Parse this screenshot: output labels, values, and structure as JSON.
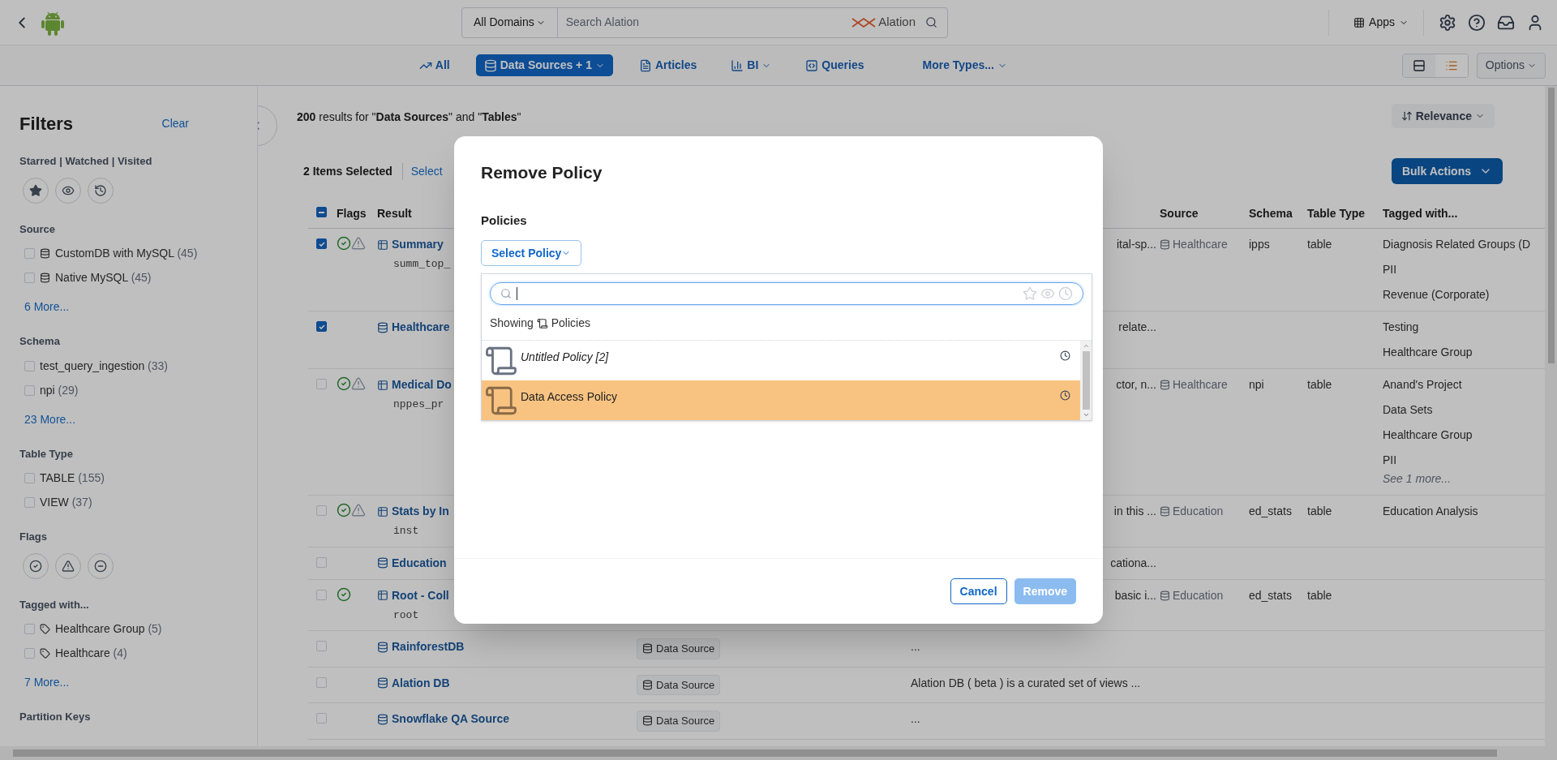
{
  "topbar": {
    "domain": "All Domains",
    "search_placeholder": "Search Alation",
    "logo_text": "Alation",
    "apps": "Apps"
  },
  "type_tabs": [
    {
      "label": "All",
      "caret": false,
      "selected": false
    },
    {
      "label": "Data Sources + 1",
      "caret": true,
      "selected": true
    },
    {
      "label": "Articles",
      "caret": false,
      "selected": false
    },
    {
      "label": "BI",
      "caret": true,
      "selected": false
    },
    {
      "label": "Queries",
      "caret": false,
      "selected": false
    },
    {
      "label": "More Types...",
      "caret": true,
      "selected": false
    }
  ],
  "view_toggle": [
    {
      "kind": "compact",
      "selected": false
    },
    {
      "kind": "list",
      "selected": true
    }
  ],
  "options": "Options",
  "filters": {
    "title": "Filters",
    "clear": "Clear",
    "sections": [
      {
        "kind": "saved",
        "title": "Starred | Watched | Visited"
      },
      {
        "kind": "checks",
        "title": "Source",
        "items": [
          {
            "kind": "source",
            "label": "CustomDB with MySQL",
            "count": "(45)",
            "checked": false
          },
          {
            "kind": "source",
            "label": "Native MySQL",
            "count": "(45)",
            "checked": false
          }
        ],
        "more": "6 More..."
      },
      {
        "kind": "checks",
        "title": "Schema",
        "items": [
          {
            "kind": "plain",
            "label": "test_query_ingestion",
            "count": "(33)",
            "checked": false
          },
          {
            "kind": "plain",
            "label": "npi",
            "count": "(29)",
            "checked": false
          }
        ],
        "more": "23 More..."
      },
      {
        "kind": "checks",
        "title": "Table Type",
        "items": [
          {
            "kind": "plain",
            "label": "TABLE",
            "count": "(155)",
            "checked": false
          },
          {
            "kind": "plain",
            "label": "VIEW",
            "count": "(37)",
            "checked": false
          }
        ]
      },
      {
        "kind": "flags",
        "title": "Flags"
      },
      {
        "kind": "checks",
        "title": "Tagged with...",
        "items": [
          {
            "kind": "tag",
            "label": "Healthcare Group",
            "count": "(5)",
            "checked": false
          },
          {
            "kind": "tag",
            "label": "Healthcare",
            "count": "(4)",
            "checked": false
          }
        ],
        "more": "7 More..."
      },
      {
        "kind": "heading",
        "title": "Partition Keys"
      }
    ]
  },
  "results": {
    "summary": "**200** results for \"**Data Sources**\" and \"**Tables**\"",
    "sort": "Relevance",
    "selected_count": "2 Items Selected",
    "select_link": "Select",
    "bulk_actions": "Bulk Actions"
  },
  "table": {
    "all_checkbox": {
      "indeterminate": true
    },
    "columns": [
      "Flags",
      "Result",
      "Source",
      "Schema",
      "Table Type",
      "Tagged with..."
    ],
    "rows": [
      {
        "checked": true,
        "endorsed": true,
        "warning": true,
        "kind": "table",
        "name": "Summary",
        "sub": "summ_top_",
        "description": "ital-sp...",
        "source": "Healthcare",
        "schema": "ipps",
        "table_type": "table",
        "tags": [
          "Diagnosis Related Groups (D",
          "PII",
          "Revenue (Corporate)"
        ]
      },
      {
        "checked": true,
        "endorsed": false,
        "warning": false,
        "kind": "source",
        "name": "Healthcare",
        "description": "relate...",
        "tags": [
          "Testing",
          "Healthcare Group"
        ]
      },
      {
        "checked": false,
        "endorsed": true,
        "warning": true,
        "kind": "table",
        "name": "Medical Do",
        "sub": "nppes_pr",
        "description": "ctor, n...",
        "source": "Healthcare",
        "schema": "npi",
        "table_type": "table",
        "tags": [
          "Anand's Project",
          "Data Sets",
          "Healthcare Group",
          "PII"
        ],
        "more_tags": "See 1 more..."
      },
      {
        "checked": false,
        "endorsed": true,
        "warning": true,
        "kind": "table",
        "name": "Stats by In",
        "sub": "inst",
        "description": "in this ...",
        "source": "Education",
        "schema": "ed_stats",
        "table_type": "table",
        "tags": [
          "Education Analysis"
        ]
      },
      {
        "checked": false,
        "endorsed": false,
        "warning": false,
        "kind": "source",
        "name": "Education",
        "description": "cationa..."
      },
      {
        "checked": false,
        "endorsed": true,
        "warning": false,
        "kind": "table",
        "name": "Root - Coll",
        "sub": "root",
        "description": "basic i...",
        "source": "Education",
        "schema": "ed_stats",
        "table_type": "table"
      },
      {
        "checked": false,
        "endorsed": false,
        "warning": false,
        "kind": "source",
        "name": "RainforestDB",
        "type": "Data Source",
        "description": "..."
      },
      {
        "checked": false,
        "endorsed": false,
        "warning": false,
        "kind": "source",
        "name": "Alation DB",
        "type": "Data Source",
        "description": "Alation DB ( beta ) is a curated set of views ..."
      },
      {
        "checked": false,
        "endorsed": false,
        "warning": false,
        "kind": "source",
        "name": "Snowflake QA Source",
        "type": "Data Source",
        "description": "..."
      }
    ]
  },
  "modal": {
    "title": "Remove Policy",
    "label": "Policies",
    "dropdown": "Select Policy",
    "showing": "Showing",
    "showing_type": "Policies",
    "policies": [
      {
        "name": "Untitled Policy [2]",
        "untitled": true,
        "selected": false
      },
      {
        "name": "Data Access Policy",
        "untitled": false,
        "selected": true
      }
    ],
    "buttons": [
      {
        "label": "Cancel",
        "kind": "secondary",
        "disabled": false
      },
      {
        "label": "Remove",
        "kind": "primary",
        "disabled": true
      }
    ]
  }
}
